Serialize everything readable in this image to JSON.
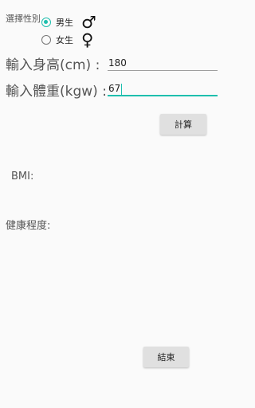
{
  "gender": {
    "label": "選擇性別",
    "options": [
      {
        "label": "男生",
        "symbol": "♂",
        "selected": true
      },
      {
        "label": "女生",
        "symbol": "♀",
        "selected": false
      }
    ]
  },
  "height": {
    "label": "輸入身高(cm) :",
    "value": "180"
  },
  "weight": {
    "label": "輸入體重(kgw) :",
    "value": "67"
  },
  "calculate_button": "計算",
  "bmi_label": "BMI:",
  "health_label": "健康程度:",
  "exit_button": "結束",
  "colors": {
    "accent": "#1fbfae",
    "background": "#fafafa",
    "button": "#e0e0e0"
  }
}
